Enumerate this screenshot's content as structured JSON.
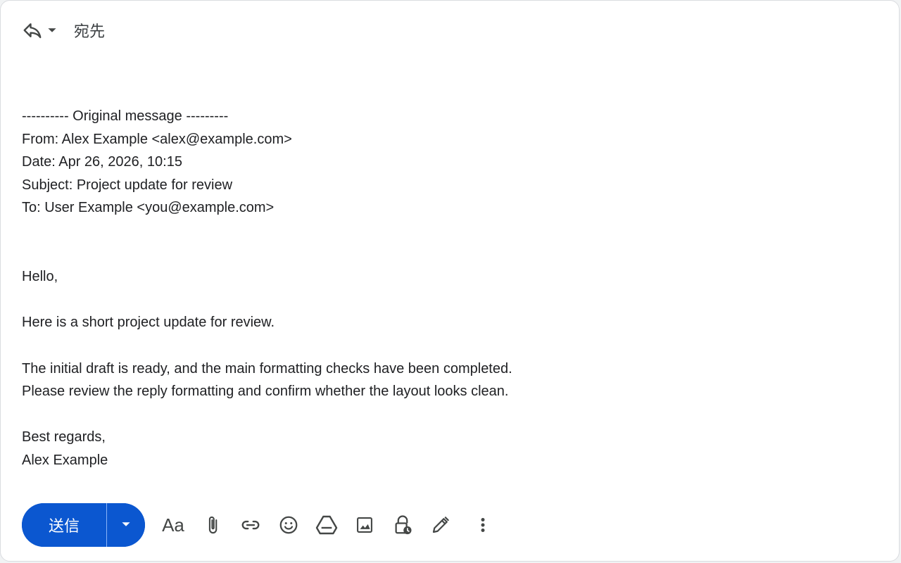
{
  "header": {
    "to_label": "宛先"
  },
  "quoted": {
    "separator": "---------- Original message ---------",
    "from": "From: Alex Example <alex@example.com>",
    "date": "Date: Apr 26, 2026, 10:15",
    "subject": "Subject: Project update for review",
    "to": "To: User Example <you@example.com>"
  },
  "message": {
    "greeting": "Hello,",
    "line1": "Here is a short project update for review.",
    "line2": "The initial draft is ready, and the main formatting checks have been completed.",
    "line3": "Please review the reply formatting and confirm whether the layout looks clean.",
    "closing": "Best regards,",
    "signature": "Alex Example"
  },
  "toolbar": {
    "send_label": "送信",
    "format_label": "Aa"
  },
  "colors": {
    "accent": "#0b57d0",
    "text": "#202124",
    "icon": "#444746"
  },
  "icons": [
    "reply-icon",
    "dropdown-arrow-icon",
    "attach-icon",
    "link-icon",
    "emoji-icon",
    "drive-icon",
    "photo-icon",
    "confidential-lock-icon",
    "signature-pen-icon",
    "more-vert-icon"
  ]
}
